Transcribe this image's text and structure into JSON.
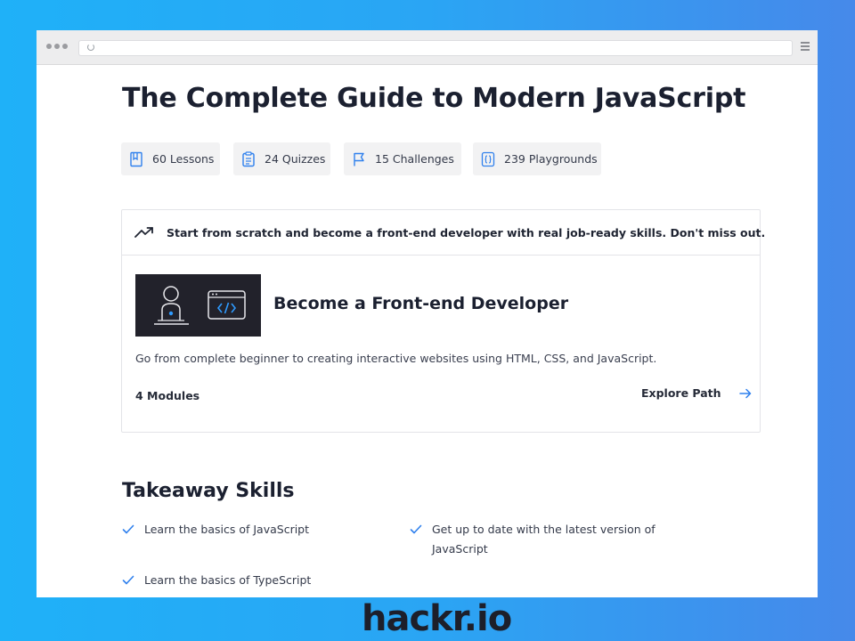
{
  "course": {
    "title": "The Complete Guide to Modern JavaScript",
    "stats": [
      {
        "label": "60 Lessons",
        "icon": "book-icon"
      },
      {
        "label": "24 Quizzes",
        "icon": "quiz-icon"
      },
      {
        "label": "15 Challenges",
        "icon": "flag-icon"
      },
      {
        "label": "239 Playgrounds",
        "icon": "code-icon"
      }
    ]
  },
  "promo_card": {
    "headline": "Start from scratch and become a front-end developer with real job-ready skills. Don't miss out.",
    "headline_icon": "trending-up-icon",
    "path_title": "Become a Front-end Developer",
    "description": "Go from complete beginner to creating interactive websites using HTML, CSS, and JavaScript.",
    "modules_label": "4 Modules",
    "explore_label": "Explore Path",
    "explore_icon": "arrow-right-icon",
    "thumbnail_icon": "developer-code-icon"
  },
  "takeaway": {
    "heading": "Takeaway Skills",
    "skills": [
      {
        "text": "Learn the basics of JavaScript",
        "text_line2": ""
      },
      {
        "text": "Get up to date with the latest version of",
        "text_line2": "JavaScript"
      },
      {
        "text": "Learn the basics of TypeScript",
        "text_line2": ""
      }
    ]
  },
  "brand": {
    "name": "hackr.io"
  },
  "colors": {
    "background_left": "#1fb1f8",
    "background_right": "#4689ea",
    "accent_blue": "#2f80ed",
    "text_dark": "#1b2030"
  }
}
